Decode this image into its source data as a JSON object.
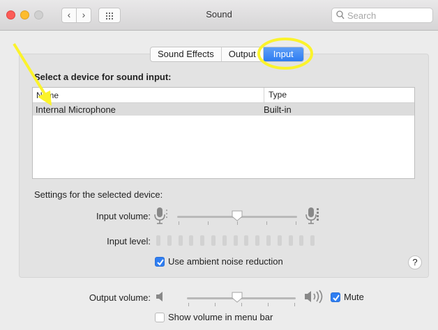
{
  "window": {
    "title": "Sound",
    "search_placeholder": "Search",
    "back_glyph": "‹",
    "forward_glyph": "›"
  },
  "tabs": [
    {
      "label": "Sound Effects",
      "active": false
    },
    {
      "label": "Output",
      "active": false
    },
    {
      "label": "Input",
      "active": true
    }
  ],
  "device_section": {
    "heading": "Select a device for sound input:",
    "columns": [
      "Name",
      "Type"
    ],
    "rows": [
      {
        "name": "Internal Microphone",
        "type": "Built-in",
        "selected": true
      }
    ]
  },
  "settings": {
    "heading": "Settings for the selected device:",
    "input_volume_label": "Input volume:",
    "input_volume_value": 0.5,
    "input_level_label": "Input level:",
    "input_level_active_bars": 0,
    "input_level_total_bars": 15,
    "ambient_noise_label": "Use ambient noise reduction",
    "ambient_noise_checked": true,
    "help_label": "?"
  },
  "output": {
    "volume_label": "Output volume:",
    "volume_value": 0.5,
    "mute_label": "Mute",
    "mute_checked": true,
    "show_in_menu_label": "Show volume in menu bar",
    "show_in_menu_checked": false
  },
  "colors": {
    "accent": "#2f7ef2",
    "highlight_annotation": "#fbf32b"
  }
}
